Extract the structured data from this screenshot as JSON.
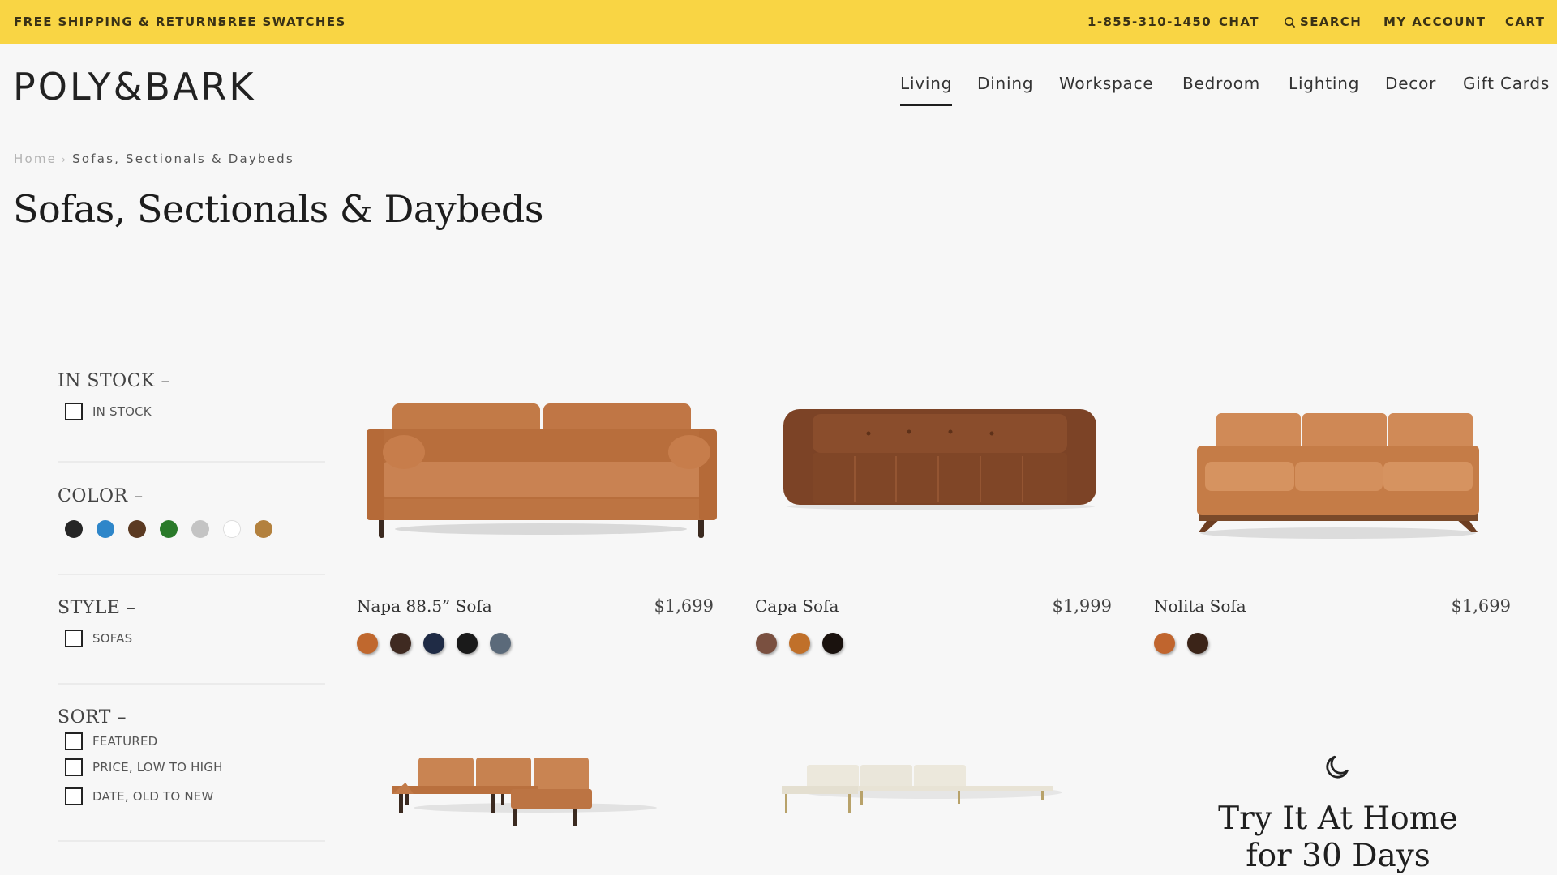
{
  "topbar": {
    "left": [
      "FREE SHIPPING & RETURNS",
      "FREE SWATCHES"
    ],
    "phone": "1-855-310-1450",
    "chat": "CHAT",
    "search": "SEARCH",
    "account": "MY ACCOUNT",
    "cart": "CART",
    "background_color": "#f9d544"
  },
  "brand": {
    "logo": "POLY&BARK"
  },
  "nav": {
    "items": [
      "Living",
      "Dining",
      "Workspace",
      "Bedroom",
      "Lighting",
      "Decor",
      "Gift Cards"
    ],
    "active": "Living"
  },
  "breadcrumb": {
    "home": "Home",
    "separator": "›",
    "current": "Sofas, Sectionals & Daybeds"
  },
  "page": {
    "title": "Sofas, Sectionals & Daybeds"
  },
  "filters": {
    "in_stock": {
      "title": "IN STOCK –",
      "options": [
        "IN STOCK"
      ]
    },
    "color": {
      "title": "COLOR –",
      "swatches": [
        "#262626",
        "#2e86c9",
        "#5b3a22",
        "#2a7a2a",
        "#c4c4c4",
        "#ffffff",
        "#b3813e"
      ]
    },
    "style": {
      "title": "STYLE –",
      "options": [
        "SOFAS"
      ]
    },
    "sort": {
      "title": "SORT –",
      "options": [
        "FEATURED",
        "PRICE, LOW TO HIGH",
        "DATE, OLD TO NEW"
      ]
    }
  },
  "products": [
    {
      "name": "Napa 88.5” Sofa",
      "price": "$1,699",
      "swatches": [
        "#c0682e",
        "#3f2a21",
        "#1f2b45",
        "#1a1a1a",
        "#5b6a7a"
      ]
    },
    {
      "name": "Capa Sofa",
      "price": "$1,999",
      "swatches": [
        "#7a5040",
        "#c0702a",
        "#1a120e"
      ]
    },
    {
      "name": "Nolita Sofa",
      "price": "$1,699",
      "swatches": [
        "#c0652e",
        "#3b2418"
      ]
    }
  ],
  "promo": {
    "icon": "moon-icon",
    "line1": "Try It At Home",
    "line2": "for 30 Days"
  }
}
